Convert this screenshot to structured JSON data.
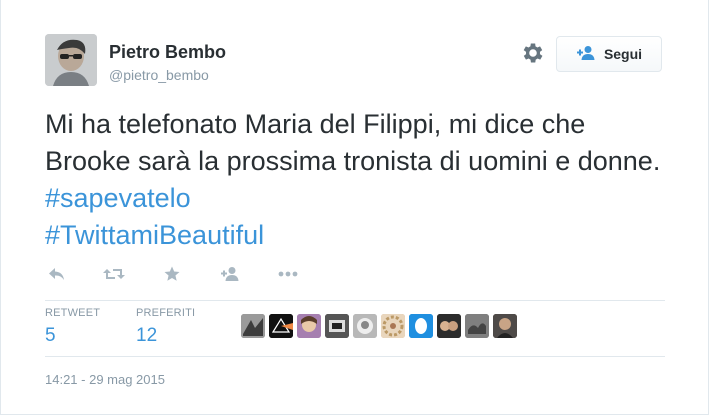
{
  "user": {
    "name": "Pietro Bembo",
    "handle": "@pietro_bembo"
  },
  "follow_button": {
    "label": "Segui"
  },
  "tweet": {
    "text_plain": "Mi ha telefonato Maria del Filippi, mi dice che Brooke sarà la prossima tronista di uomini e donne. ",
    "hashtag1": "#sapevatelo",
    "hashtag2": "#TwittamiBeautiful"
  },
  "actions": [
    "reply-icon",
    "retweet-icon",
    "favorite-icon",
    "follow-icon",
    "more-icon"
  ],
  "stats": {
    "retweet_label": "RETWEET",
    "retweet_count": "5",
    "favorites_label": "PREFERITI",
    "favorites_count": "12"
  },
  "favorited_by_avatars": 10,
  "timestamp": "14:21 - 29 mag 2015",
  "colors": {
    "text": "#292f33",
    "muted": "#8899a6",
    "link": "#3b94d9",
    "border": "#e1e8ed"
  }
}
